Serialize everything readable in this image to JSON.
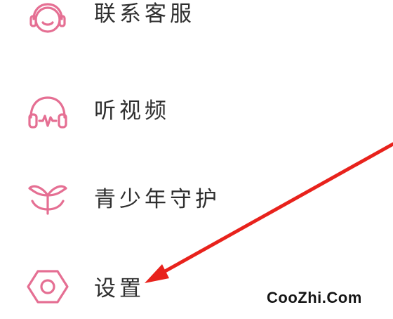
{
  "menu": {
    "items": [
      {
        "label": "联系客服",
        "icon": "customer-service-headset-icon"
      },
      {
        "label": "听视频",
        "icon": "headphones-icon"
      },
      {
        "label": "青少年守护",
        "icon": "sprout-icon"
      },
      {
        "label": "设置",
        "icon": "settings-hexagon-icon"
      }
    ]
  },
  "watermark": {
    "text": "CooZhi.Com"
  },
  "colors": {
    "icon_pink": "#e56f93",
    "label_text": "#2f2f2f",
    "arrow_red": "#e8221c",
    "watermark_text": "#151515"
  }
}
